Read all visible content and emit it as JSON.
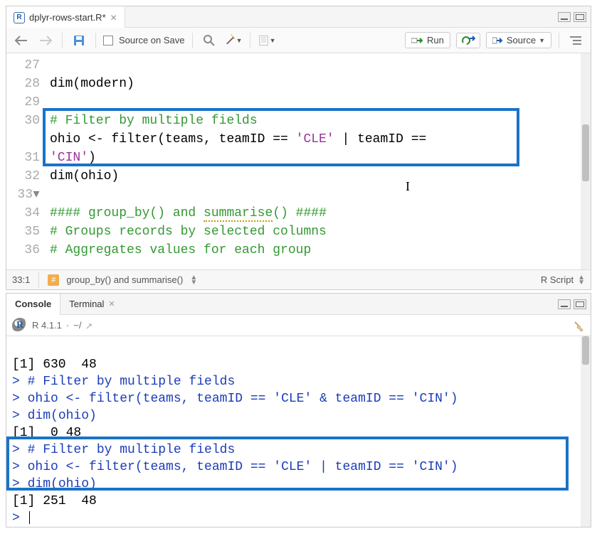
{
  "editor": {
    "filename": "dplyr-rows-start.R*",
    "source_on_save_label": "Source on Save",
    "run_label": "Run",
    "source_label": "Source",
    "lines": {
      "l27": {
        "n": "27",
        "a": "dim(modern)"
      },
      "l28": {
        "n": "28",
        "a": ""
      },
      "l29": {
        "n": "29",
        "a": "# Filter by multiple fields"
      },
      "l30": {
        "n": "30",
        "a": "ohio <- filter(teams, teamID == ",
        "s1": "'CLE'",
        "b": " | teamID == ",
        "s2": "'CIN'",
        "c": ")"
      },
      "l31": {
        "n": "31",
        "a": "dim(ohio)"
      },
      "l32": {
        "n": "32",
        "a": ""
      },
      "l33": {
        "n": "33",
        "a": "#### group_by() and ",
        "sq": "summarise",
        "b": "() ####"
      },
      "l34": {
        "n": "34",
        "a": "# Groups records by selected columns"
      },
      "l35": {
        "n": "35",
        "a": "# Aggregates values for each group"
      },
      "l36": {
        "n": "36",
        "a": ""
      }
    },
    "cursor_pos": "33:1",
    "section_label": "group_by() and summarise()",
    "lang_label": "R Script"
  },
  "console": {
    "tab_console": "Console",
    "tab_terminal": "Terminal",
    "r_version": "R 4.1.1",
    "wd": "~/",
    "lines": {
      "l1": "[1] 630  48",
      "l2p": "> ",
      "l2": "# Filter by multiple fields",
      "l3p": "> ",
      "l3a": "ohio <- filter(teams, teamID == ",
      "l3s1": "'CLE'",
      "l3b": " & teamID == ",
      "l3s2": "'CIN'",
      "l3c": ")",
      "l4p": "> ",
      "l4": "dim(ohio)",
      "l5": "[1]  0 48",
      "l6p": "> ",
      "l6": "# Filter by multiple fields",
      "l7p": "> ",
      "l7a": "ohio <- filter(teams, teamID == ",
      "l7s1": "'CLE'",
      "l7b": " | teamID == ",
      "l7s2": "'CIN'",
      "l7c": ")",
      "l8p": "> ",
      "l8": "dim(ohio)",
      "l9": "[1] 251  48",
      "l10p": "> "
    }
  }
}
